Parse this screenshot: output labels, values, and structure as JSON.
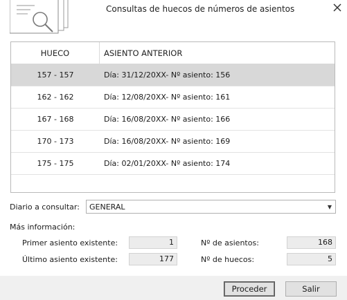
{
  "dialog": {
    "title": "Consultas de huecos de números de asientos"
  },
  "table": {
    "headers": [
      "HUECO",
      "ASIENTO ANTERIOR"
    ],
    "rows": [
      {
        "hueco": "157 - 157",
        "asiento": "Día: 31/12/20XX- Nº asiento: 156"
      },
      {
        "hueco": "162 - 162",
        "asiento": "Día: 12/08/20XX- Nº asiento: 161"
      },
      {
        "hueco": "167 - 168",
        "asiento": "Día: 16/08/20XX- Nº asiento: 166"
      },
      {
        "hueco": "170 - 173",
        "asiento": "Día: 16/08/20XX- Nº asiento: 169"
      },
      {
        "hueco": "175 - 175",
        "asiento": "Día: 02/01/20XX- Nº asiento: 174"
      }
    ]
  },
  "diario": {
    "label": "Diario a consultar:",
    "value": "GENERAL"
  },
  "info": {
    "heading": "Más información:",
    "primer_label": "Primer asiento existente:",
    "primer_value": "1",
    "ultimo_label": "Último asiento existente:",
    "ultimo_value": "177",
    "num_asientos_label": "Nº de asientos:",
    "num_asientos_value": "168",
    "num_huecos_label": "Nº de huecos:",
    "num_huecos_value": "5"
  },
  "buttons": {
    "proceder": "Proceder",
    "salir": "Salir"
  },
  "icons": {
    "header": "document-search-icon",
    "close": "close-icon",
    "dropdown": "chevron-down-icon"
  }
}
